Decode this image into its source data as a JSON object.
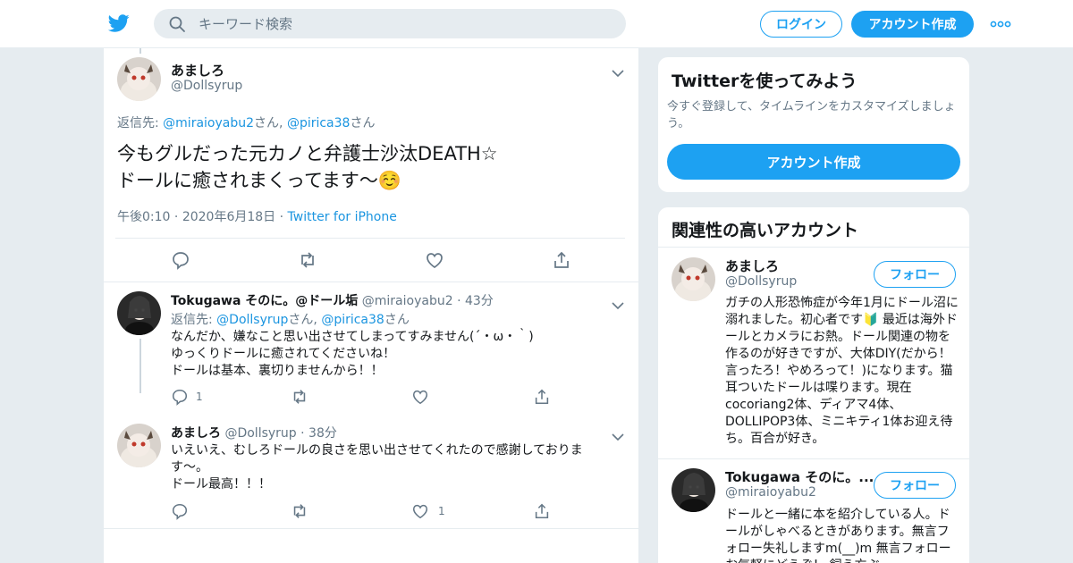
{
  "header": {
    "search_placeholder": "キーワード検索",
    "login_label": "ログイン",
    "signup_label": "アカウント作成",
    "more_icon": "more-dots-icon",
    "brand_color": "#1da1f2"
  },
  "focused_tweet": {
    "name": "あましろ",
    "handle": "@Dollsyrup",
    "reply_prefix": "返信先: ",
    "reply_to_1": "@miraioyabu2",
    "reply_san_1": "さん, ",
    "reply_to_2": "@pirica38",
    "reply_san_2": "さん",
    "text_line1": "今もグルだった元カノと弁護士沙汰DEATH☆",
    "text_line2": "ドールに癒されまくってます〜☺️",
    "time": "午後0:10",
    "date": "2020年6月18日",
    "source": "Twitter for iPhone"
  },
  "replies": [
    {
      "name": "Tokugawa そのに。@ドール垢",
      "handle": "@miraioyabu2",
      "time": "43分",
      "reply_prefix": "返信先: ",
      "reply_to_1": "@Dollsyrup",
      "reply_san_1": "さん, ",
      "reply_to_2": "@pirica38",
      "reply_san_2": "さん",
      "text": "なんだか、嫌なこと思い出させてしまってすみません(´・ω・｀)\nゆっくりドールに癒されてくださいね！\nドールは基本、裏切りませんから！！",
      "reply_count": "1",
      "like_count": ""
    },
    {
      "name": "あましろ",
      "handle": "@Dollsyrup",
      "time": "38分",
      "text": "いえいえ、むしろドールの良さを思い出させてくれたので感謝しております〜。\nドール最高！！！",
      "reply_count": "",
      "like_count": "1"
    }
  ],
  "signup_card": {
    "title": "Twitterを使ってみよう",
    "subtitle": "今すぐ登録して、タイムラインをカスタマイズしましょう。",
    "button": "アカウント作成"
  },
  "related_card": {
    "title": "関連性の高いアカウント",
    "accounts": [
      {
        "name": "あましろ",
        "handle": "@Dollsyrup",
        "follow": "フォロー",
        "bio": "ガチの人形恐怖症が今年1月にドール沼に溺れました。初心者です🔰 最近は海外ドールとカメラにお熱。ドール関連の物を作るのが好きですが、大体DIY(だから！言ったろ！やめろって！)になります。猫耳ついたドールは喋ります。現在cocoriang2体、ディアマ4体、DOLLIPOP3体、ミニキティ1体お迎え待ち。百合が好き。"
      },
      {
        "name": "Tokugawa そのに。...",
        "handle": "@miraioyabu2",
        "follow": "フォロー",
        "bio": "ドールと一緒に本を紹介している人。ドールがしゃべるときがあります。無言フォロー失礼しますm(__)m 無言フォロー お気軽にどうぞ！ 飼う方ぶ"
      }
    ]
  }
}
